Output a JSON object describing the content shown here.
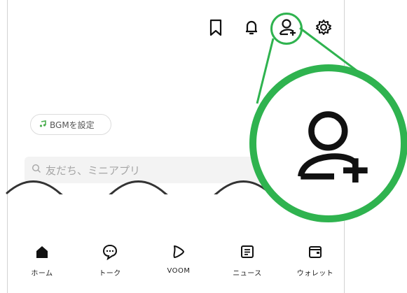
{
  "header": {
    "icons": [
      "bookmark-icon",
      "bell-icon",
      "add-friend-icon",
      "gear-icon"
    ]
  },
  "bgm": {
    "label": "BGMを設定",
    "icon": "music-note-icon"
  },
  "search": {
    "placeholder": "友だち、ミニアプリ",
    "icon": "search-icon"
  },
  "nav": {
    "items": [
      {
        "label": "ホーム",
        "icon": "home-icon"
      },
      {
        "label": "トーク",
        "icon": "chat-icon"
      },
      {
        "label": "VOOM",
        "icon": "voom-icon"
      },
      {
        "label": "ニュース",
        "icon": "news-icon"
      },
      {
        "label": "ウォレット",
        "icon": "wallet-icon"
      }
    ]
  },
  "colors": {
    "highlight": "#2fb34f",
    "bgm_note": "#4caf50"
  }
}
